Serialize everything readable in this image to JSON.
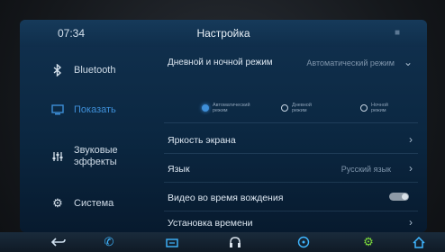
{
  "status_bar": {
    "time": "07:34",
    "title": "Настройка"
  },
  "sidebar": {
    "items": [
      {
        "label": "Bluetooth",
        "icon": "bluetooth-icon",
        "active": false
      },
      {
        "label": "Показать",
        "icon": "display-icon",
        "active": true
      },
      {
        "label": "Звуковые эффекты",
        "icon": "equalizer-icon",
        "active": false
      },
      {
        "label": "Система",
        "icon": "gear-icon",
        "active": false
      }
    ]
  },
  "settings": {
    "day_night": {
      "label": "Дневной и ночной режим",
      "value": "Автоматический режим",
      "options": [
        {
          "label": "Автоматический режим",
          "selected": true
        },
        {
          "label": "Дневной режим",
          "selected": false
        },
        {
          "label": "Ночной режим",
          "selected": false
        }
      ]
    },
    "brightness": {
      "label": "Яркость экрана"
    },
    "language": {
      "label": "Язык",
      "value": "Русский язык"
    },
    "video_while_driving": {
      "label": "Видео во время вождения",
      "enabled": false
    },
    "time_setting": {
      "label": "Установка времени"
    }
  },
  "dock": {
    "items": [
      {
        "icon": "back-icon",
        "color": "#cfe0ef"
      },
      {
        "icon": "phone-icon",
        "color": "#3fb6ff"
      },
      {
        "icon": "radio-icon",
        "color": "#3fb6ff"
      },
      {
        "icon": "headphones-icon",
        "color": "#d9e3ec"
      },
      {
        "icon": "steering-wheel-icon",
        "color": "#3fb6ff"
      },
      {
        "icon": "settings-icon",
        "color": "#7ddc3c"
      },
      {
        "icon": "home-icon",
        "color": "#3fb6ff"
      }
    ]
  },
  "colors": {
    "accent": "#3e8fd8",
    "background": "#0b2741"
  }
}
